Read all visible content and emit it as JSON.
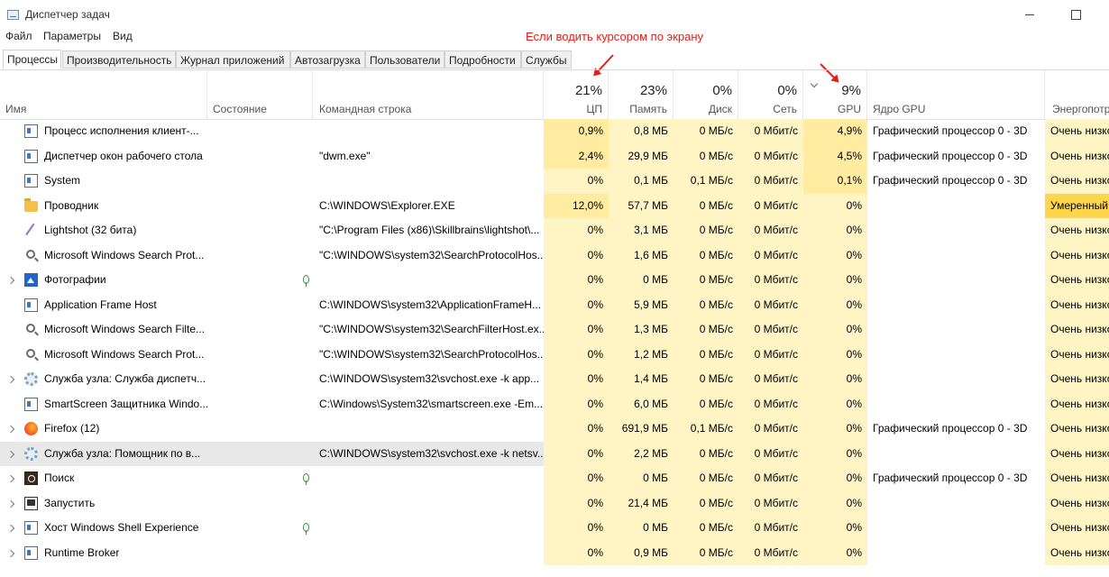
{
  "window": {
    "title": "Диспетчер задач"
  },
  "menu": [
    "Файл",
    "Параметры",
    "Вид"
  ],
  "annotation": "Если водить курсором по экрану",
  "tabs": [
    "Процессы",
    "Производительность",
    "Журнал приложений",
    "Автозагрузка",
    "Пользователи",
    "Подробности",
    "Службы"
  ],
  "header": {
    "name": "Имя",
    "status": "Состояние",
    "cmd": "Командная строка",
    "cpu": {
      "pct": "21%",
      "label": "ЦП"
    },
    "mem": {
      "pct": "23%",
      "label": "Память"
    },
    "disk": {
      "pct": "0%",
      "label": "Диск"
    },
    "net": {
      "pct": "0%",
      "label": "Сеть"
    },
    "gpu": {
      "pct": "9%",
      "label": "GPU"
    },
    "gpu_engine": "Ядро GPU",
    "power": "Энергопотр"
  },
  "rows": [
    {
      "name": "Процесс исполнения клиент-...",
      "cmd": "",
      "cpu": "0,9%",
      "mem": "0,8 МБ",
      "disk": "0 МБ/с",
      "net": "0 Мбит/с",
      "gpu": "4,9%",
      "engine": "Графический процессор 0 - 3D",
      "power": "Очень низко"
    },
    {
      "name": "Диспетчер окон рабочего стола",
      "cmd": "\"dwm.exe\"",
      "cpu": "2,4%",
      "mem": "29,9 МБ",
      "disk": "0 МБ/с",
      "net": "0 Мбит/с",
      "gpu": "4,5%",
      "engine": "Графический процессор 0 - 3D",
      "power": "Очень низко"
    },
    {
      "name": "System",
      "cmd": "",
      "cpu": "0%",
      "mem": "0,1 МБ",
      "disk": "0,1 МБ/с",
      "net": "0 Мбит/с",
      "gpu": "0,1%",
      "engine": "Графический процессор 0 - 3D",
      "power": "Очень низко"
    },
    {
      "name": "Проводник",
      "cmd": "C:\\WINDOWS\\Explorer.EXE",
      "cpu": "12,0%",
      "mem": "57,7 МБ",
      "disk": "0 МБ/с",
      "net": "0 Мбит/с",
      "gpu": "0%",
      "engine": "",
      "power": "Умеренный"
    },
    {
      "name": "Lightshot (32 бита)",
      "cmd": "\"C:\\Program Files (x86)\\Skillbrains\\lightshot\\...",
      "cpu": "0%",
      "mem": "3,1 МБ",
      "disk": "0 МБ/с",
      "net": "0 Мбит/с",
      "gpu": "0%",
      "engine": "",
      "power": "Очень низко"
    },
    {
      "name": "Microsoft Windows Search Prot...",
      "cmd": "\"C:\\WINDOWS\\system32\\SearchProtocolHos...",
      "cpu": "0%",
      "mem": "1,6 МБ",
      "disk": "0 МБ/с",
      "net": "0 Мбит/с",
      "gpu": "0%",
      "engine": "",
      "power": "Очень низко"
    },
    {
      "name": "Фотографии",
      "cmd": "",
      "cpu": "0%",
      "mem": "0 МБ",
      "disk": "0 МБ/с",
      "net": "0 Мбит/с",
      "gpu": "0%",
      "engine": "",
      "power": "Очень низко"
    },
    {
      "name": "Application Frame Host",
      "cmd": "C:\\WINDOWS\\system32\\ApplicationFrameH...",
      "cpu": "0%",
      "mem": "5,9 МБ",
      "disk": "0 МБ/с",
      "net": "0 Мбит/с",
      "gpu": "0%",
      "engine": "",
      "power": "Очень низко"
    },
    {
      "name": "Microsoft Windows Search Filte...",
      "cmd": "\"C:\\WINDOWS\\system32\\SearchFilterHost.ex...",
      "cpu": "0%",
      "mem": "1,3 МБ",
      "disk": "0 МБ/с",
      "net": "0 Мбит/с",
      "gpu": "0%",
      "engine": "",
      "power": "Очень низко"
    },
    {
      "name": "Microsoft Windows Search Prot...",
      "cmd": "\"C:\\WINDOWS\\system32\\SearchProtocolHos...",
      "cpu": "0%",
      "mem": "1,2 МБ",
      "disk": "0 МБ/с",
      "net": "0 Мбит/с",
      "gpu": "0%",
      "engine": "",
      "power": "Очень низко"
    },
    {
      "name": "Служба узла: Служба диспетч...",
      "cmd": "C:\\WINDOWS\\system32\\svchost.exe -k app...",
      "cpu": "0%",
      "mem": "1,4 МБ",
      "disk": "0 МБ/с",
      "net": "0 Мбит/с",
      "gpu": "0%",
      "engine": "",
      "power": "Очень низко"
    },
    {
      "name": "SmartScreen Защитника Windo...",
      "cmd": "C:\\Windows\\System32\\smartscreen.exe -Em...",
      "cpu": "0%",
      "mem": "6,0 МБ",
      "disk": "0 МБ/с",
      "net": "0 Мбит/с",
      "gpu": "0%",
      "engine": "",
      "power": "Очень низко"
    },
    {
      "name": "Firefox (12)",
      "cmd": "",
      "cpu": "0%",
      "mem": "691,9 МБ",
      "disk": "0,1 МБ/с",
      "net": "0 Мбит/с",
      "gpu": "0%",
      "engine": "Графический процессор 0 - 3D",
      "power": "Очень низко"
    },
    {
      "name": "Служба узла: Помощник по в...",
      "cmd": "C:\\WINDOWS\\system32\\svchost.exe -k netsv...",
      "cpu": "0%",
      "mem": "2,2 МБ",
      "disk": "0 МБ/с",
      "net": "0 Мбит/с",
      "gpu": "0%",
      "engine": "",
      "power": "Очень низко"
    },
    {
      "name": "Поиск",
      "cmd": "",
      "cpu": "0%",
      "mem": "0 МБ",
      "disk": "0 МБ/с",
      "net": "0 Мбит/с",
      "gpu": "0%",
      "engine": "Графический процессор 0 - 3D",
      "power": "Очень низко"
    },
    {
      "name": "Запустить",
      "cmd": "",
      "cpu": "0%",
      "mem": "21,4 МБ",
      "disk": "0 МБ/с",
      "net": "0 Мбит/с",
      "gpu": "0%",
      "engine": "",
      "power": "Очень низко"
    },
    {
      "name": "Хост Windows Shell Experience",
      "cmd": "",
      "cpu": "0%",
      "mem": "0 МБ",
      "disk": "0 МБ/с",
      "net": "0 Мбит/с",
      "gpu": "0%",
      "engine": "",
      "power": "Очень низко"
    },
    {
      "name": "Runtime Broker",
      "cmd": "",
      "cpu": "0%",
      "mem": "0,9 МБ",
      "disk": "0 МБ/с",
      "net": "0 Мбит/с",
      "gpu": "0%",
      "engine": "",
      "power": "Очень низко"
    }
  ]
}
